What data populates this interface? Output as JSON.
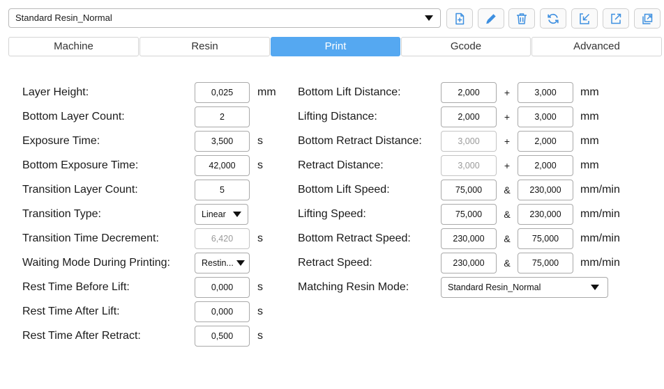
{
  "profile": {
    "selected": "Standard Resin_Normal"
  },
  "toolbar": {
    "buttons": [
      {
        "name": "new-profile-button",
        "icon": "add-file-icon"
      },
      {
        "name": "edit-profile-button",
        "icon": "pencil-icon"
      },
      {
        "name": "delete-profile-button",
        "icon": "trash-icon"
      },
      {
        "name": "reset-profile-button",
        "icon": "refresh-icon"
      },
      {
        "name": "import-profile-button",
        "icon": "import-icon"
      },
      {
        "name": "export-profile-button",
        "icon": "export-icon"
      },
      {
        "name": "copy-profile-button",
        "icon": "copy-icon"
      }
    ]
  },
  "tabs": [
    {
      "label": "Machine",
      "active": false
    },
    {
      "label": "Resin",
      "active": false
    },
    {
      "label": "Print",
      "active": true
    },
    {
      "label": "Gcode",
      "active": false
    },
    {
      "label": "Advanced",
      "active": false
    }
  ],
  "left": [
    {
      "label": "Layer Height:",
      "value": "0,025",
      "unit": "mm"
    },
    {
      "label": "Bottom Layer Count:",
      "value": "2",
      "unit": ""
    },
    {
      "label": "Exposure Time:",
      "value": "3,500",
      "unit": "s"
    },
    {
      "label": "Bottom Exposure Time:",
      "value": "42,000",
      "unit": "s"
    },
    {
      "label": "Transition Layer Count:",
      "value": "5",
      "unit": ""
    },
    {
      "label": "Transition Type:",
      "value": "Linear",
      "unit": ""
    },
    {
      "label": "Transition Time Decrement:",
      "value": "6,420",
      "unit": "s"
    },
    {
      "label": "Waiting Mode During Printing:",
      "value": "Restin...",
      "unit": ""
    },
    {
      "label": "Rest Time Before Lift:",
      "value": "0,000",
      "unit": "s"
    },
    {
      "label": "Rest Time After Lift:",
      "value": "0,000",
      "unit": "s"
    },
    {
      "label": "Rest Time After Retract:",
      "value": "0,500",
      "unit": "s"
    }
  ],
  "right": [
    {
      "label": "Bottom Lift Distance:",
      "value1": "2,000",
      "op": "+",
      "value2": "3,000",
      "unit": "mm"
    },
    {
      "label": "Lifting Distance:",
      "value1": "2,000",
      "op": "+",
      "value2": "3,000",
      "unit": "mm"
    },
    {
      "label": "Bottom Retract Distance:",
      "value1": "3,000",
      "op": "+",
      "value2": "2,000",
      "unit": "mm"
    },
    {
      "label": "Retract Distance:",
      "value1": "3,000",
      "op": "+",
      "value2": "2,000",
      "unit": "mm"
    },
    {
      "label": "Bottom Lift Speed:",
      "value1": "75,000",
      "op": "&",
      "value2": "230,000",
      "unit": "mm/min"
    },
    {
      "label": "Lifting Speed:",
      "value1": "75,000",
      "op": "&",
      "value2": "230,000",
      "unit": "mm/min"
    },
    {
      "label": "Bottom Retract Speed:",
      "value1": "230,000",
      "op": "&",
      "value2": "75,000",
      "unit": "mm/min"
    },
    {
      "label": "Retract Speed:",
      "value1": "230,000",
      "op": "&",
      "value2": "75,000",
      "unit": "mm/min"
    },
    {
      "label": "Matching Resin Mode:",
      "value": "Standard Resin_Normal"
    }
  ],
  "colors": {
    "accent": "#55a8f1",
    "icon": "#3d8fe0"
  }
}
